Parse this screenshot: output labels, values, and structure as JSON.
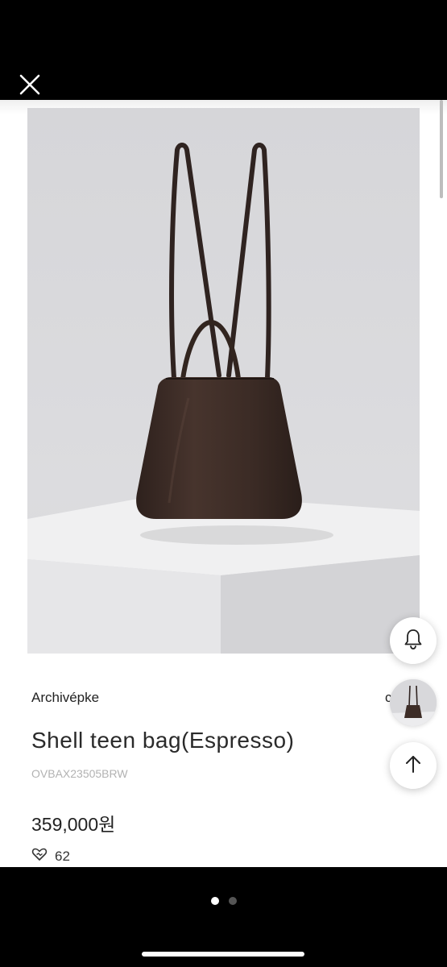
{
  "header": {
    "close_icon": "close-icon"
  },
  "product": {
    "brand": "Archivépke",
    "title": "Shell teen bag(Espresso)",
    "sku": "OVBAX23505BRW",
    "price": "359,000원",
    "likes_count": "62",
    "like_icon": "heart-outline-icon",
    "image_subject": "espresso brown leather backpack on white pedestal",
    "bag_color": "#3a2a25",
    "background_color": "#dcdcdf"
  },
  "floating_buttons": {
    "notify_icon": "bell-icon",
    "scroll_top_icon": "arrow-up-icon",
    "recent_thumbnail_icon": "product-thumbnail"
  },
  "pagination": {
    "total": 2,
    "active_index": 0
  }
}
